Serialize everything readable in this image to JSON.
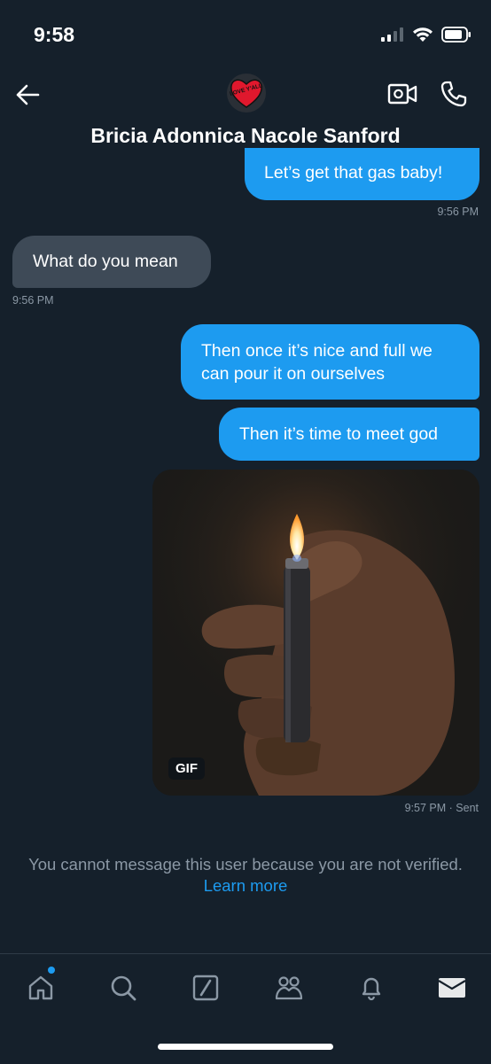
{
  "status": {
    "time": "9:58"
  },
  "header": {
    "contact_name": "Bricia Adonnica Nacole Sanford",
    "avatar_text": "LOVE Y'ALL"
  },
  "messages": [
    {
      "id": "m1",
      "type": "sent",
      "text": "Let’s get that gas baby!",
      "time": "9:56 PM"
    },
    {
      "id": "m2",
      "type": "received",
      "text": "What do you mean",
      "time": "9:56 PM"
    },
    {
      "id": "m3",
      "type": "sent",
      "text": "Then once it’s nice and full we can pour it on ourselves"
    },
    {
      "id": "m4",
      "type": "sent",
      "text": "Then it’s time to meet god"
    },
    {
      "id": "m5",
      "type": "sent-gif",
      "badge": "GIF",
      "time": "9:57 PM",
      "status": "· Sent"
    }
  ],
  "notice": {
    "text": "You cannot message this user because you are not verified.",
    "link": "Learn more"
  },
  "tabs": [
    "home-icon",
    "search-icon",
    "grok-icon",
    "communities-icon",
    "notifications-icon",
    "messages-icon"
  ],
  "colors": {
    "background": "#15202b",
    "sent_bubble": "#1d9bf0",
    "received_bubble": "#3e4a57",
    "accent": "#1d9bf0"
  }
}
